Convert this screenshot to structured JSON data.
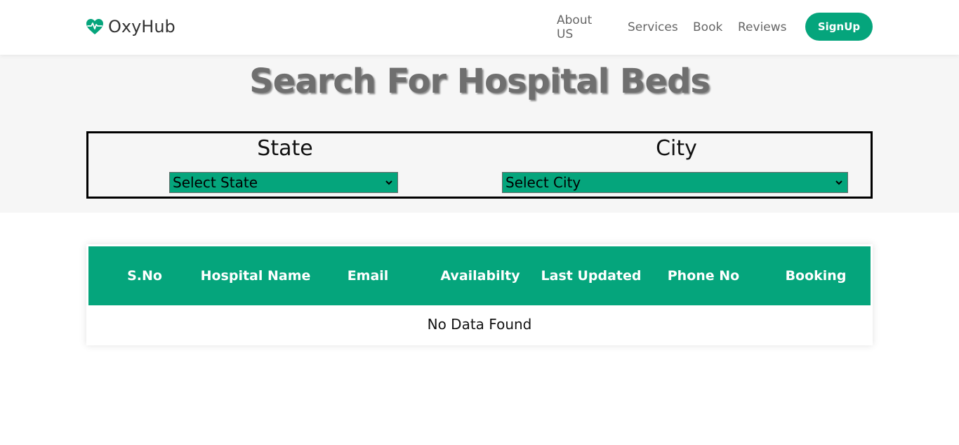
{
  "nav": {
    "brand": "OxyHub",
    "links": [
      "About US",
      "Services",
      "Book",
      "Reviews"
    ],
    "signup_label": "SignUp"
  },
  "search": {
    "title": "Search For Hospital Beds",
    "state_label": "State",
    "state_selected": "Select State",
    "city_label": "City",
    "city_selected": "Select City"
  },
  "table": {
    "headers": [
      "S.No",
      "Hospital Name",
      "Email",
      "Availabilty",
      "Last Updated",
      "Phone No",
      "Booking"
    ],
    "empty_message": "No Data Found"
  },
  "colors": {
    "accent": "#05a57c",
    "band": "#f6f6f6",
    "title": "#6f6f6f"
  },
  "icons": {
    "brand": "heart-pulse-icon",
    "select": "chevron-down-icon"
  }
}
